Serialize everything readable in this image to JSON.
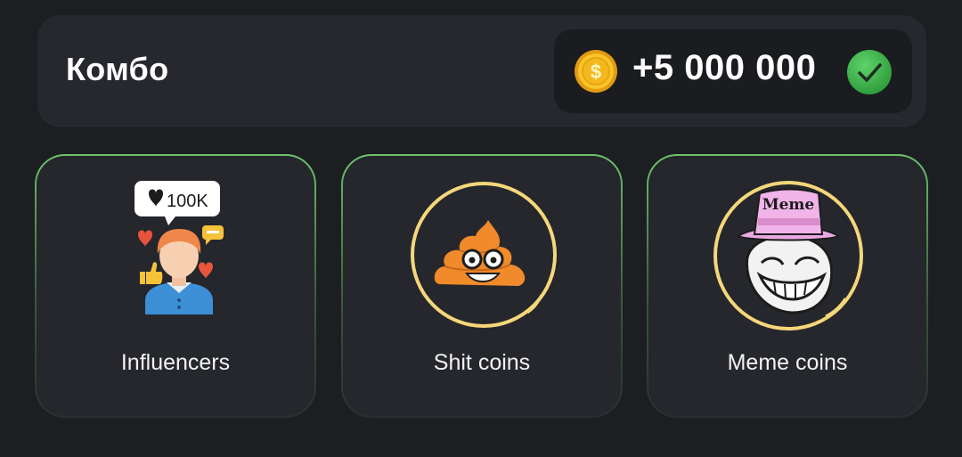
{
  "header": {
    "title": "Комбо",
    "reward": "+5 000 000"
  },
  "icons": {
    "coin": "gold-coin-icon",
    "check": "check-circle-icon"
  },
  "cards": [
    {
      "label": "Influencers",
      "badge": "100K",
      "icon": "influencer-icon"
    },
    {
      "label": "Shit coins",
      "icon": "poop-emoji-icon"
    },
    {
      "label": "Meme coins",
      "hat_text": "Meme",
      "icon": "troll-face-icon"
    }
  ],
  "colors": {
    "background": "#1c1e22",
    "panel": "#26282d",
    "card_border_accent": "#6cc36c",
    "check_green": "#3bb54a",
    "coin_gold": "#f4b81c",
    "ring_gold": "#f5d77a"
  }
}
